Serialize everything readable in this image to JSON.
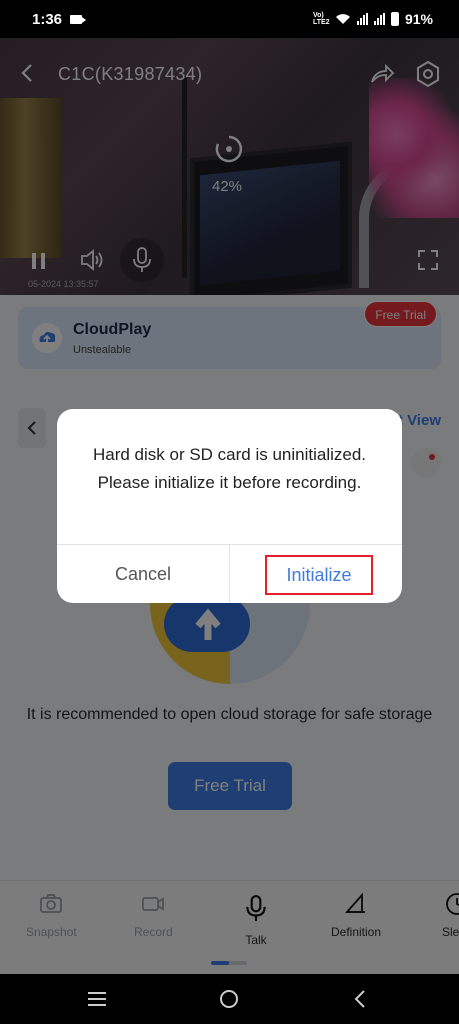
{
  "status_bar": {
    "time": "1:36",
    "network": "Vo) LTE2",
    "battery": "91%"
  },
  "device": {
    "title": "C1C(K31987434)"
  },
  "player": {
    "loading_percent": "42%",
    "timestamp": "05-2024 13:35:57"
  },
  "cloud_card": {
    "name": "CloudPlay",
    "subtitle": "Unstealable",
    "badge": "Free Trial"
  },
  "timeline": {
    "view_link": "Event View"
  },
  "cloud_promo": {
    "text": "It is recommended to open cloud storage for safe storage",
    "button": "Free Trial"
  },
  "toolbar": {
    "items": [
      {
        "label": "Snapshot",
        "icon": "camera-icon",
        "enabled": false
      },
      {
        "label": "Record",
        "icon": "video-record-icon",
        "enabled": false
      },
      {
        "label": "Talk",
        "icon": "microphone-icon",
        "enabled": true
      },
      {
        "label": "Definition",
        "icon": "definition-icon",
        "enabled": true
      },
      {
        "label": "Sleep",
        "icon": "sleep-icon",
        "enabled": true
      }
    ]
  },
  "dialog": {
    "message": "Hard disk or SD card is uninitialized. Please initialize it before recording.",
    "cancel_label": "Cancel",
    "confirm_label": "Initialize"
  },
  "colors": {
    "accent": "#3e7de6",
    "badge_red": "#e8333b",
    "highlight_red": "#e0202a"
  }
}
